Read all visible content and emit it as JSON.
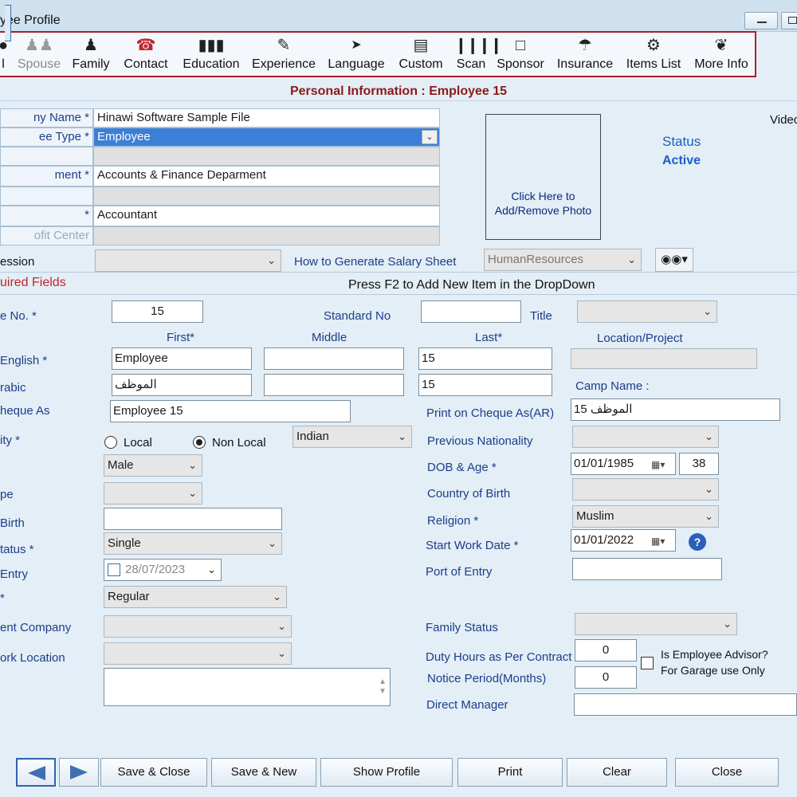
{
  "window": {
    "title": "yee Profile"
  },
  "colors": {
    "toolbar_border": "#a8212a",
    "header_text": "#8b1a1a",
    "label_blue": "#1c3d8a",
    "selection": "#3c7fd6"
  },
  "toolbar": {
    "items": [
      {
        "label": "l",
        "icon": "person-icon"
      },
      {
        "label": "Spouse",
        "icon": "couple-icon"
      },
      {
        "label": "Family",
        "icon": "family-icon"
      },
      {
        "label": "Contact",
        "icon": "phone-icon"
      },
      {
        "label": "Education",
        "icon": "books-icon"
      },
      {
        "label": "Experience",
        "icon": "certificate-icon"
      },
      {
        "label": "Language",
        "icon": "language-icon"
      },
      {
        "label": "Custom",
        "icon": "custom-icon"
      },
      {
        "label": "Scan",
        "icon": "barcode-icon"
      },
      {
        "label": "Sponsor",
        "icon": "sponsor-icon"
      },
      {
        "label": "Insurance",
        "icon": "umbrella-icon"
      },
      {
        "label": "Items List",
        "icon": "tools-icon"
      },
      {
        "label": "More Info",
        "icon": "handshake-icon"
      }
    ]
  },
  "header": {
    "personal_info": "Personal Information : Employee 15"
  },
  "top_grid": {
    "rows": [
      {
        "label": "ny Name  *",
        "value": "Hinawi Software Sample File"
      },
      {
        "label": "ee Type  *",
        "value": "Employee"
      },
      {
        "label": "",
        "value": ""
      },
      {
        "label": "ment  *",
        "value": "Accounts & Finance Deparment"
      },
      {
        "label": "",
        "value": ""
      },
      {
        "label": "*",
        "value": "Accountant"
      },
      {
        "label": "ofit Center",
        "value": ""
      }
    ]
  },
  "photo": {
    "text": "Click Here to Add/Remove Photo"
  },
  "status": {
    "label": "Status",
    "value": "Active"
  },
  "video_label": "Videc",
  "profession_label": "ession",
  "salary_sheet_label": "How to Generate Salary Sheet",
  "hr_dropdown": "HumanResources",
  "binoculars_icon": "binoculars-icon",
  "required_fields": "uired Fields",
  "press_f2": "Press F2 to Add New Item in the DropDown",
  "form": {
    "employee_no_label": "e No.  *",
    "employee_no": "15",
    "standard_no_label": "Standard No",
    "standard_no": "",
    "title_label": "Title",
    "first_label": "First*",
    "middle_label": "Middle",
    "last_label": "Last*",
    "location_label": "Location/Project",
    "name_en_label": "English  *",
    "first_en": "Employee",
    "middle_en": "",
    "last_en": "15",
    "name_ar_label": "rabic",
    "first_ar": "الموظف",
    "middle_ar": "",
    "last_ar": "15",
    "camp_label": "Camp Name :",
    "cheque_label": "heque As",
    "cheque_value": "Employee 15",
    "cheque_ar_label": "Print on Cheque As(AR)",
    "cheque_ar_value": "الموظف 15",
    "nationality_label": "ity  *",
    "local_label": "Local",
    "nonlocal_label": "Non Local",
    "nationality_value": "Indian",
    "prev_nationality_label": "Previous Nationality",
    "gender_value": "Male",
    "dob_label": "DOB & Age  *",
    "dob_value": "01/01/1985",
    "age_value": "38",
    "type_label": "pe",
    "country_birth_label": "Country of Birth",
    "place_birth_label": "Birth",
    "religion_label": "Religion  *",
    "religion_value": "Muslim",
    "marital_label": "tatus  *",
    "marital_value": "Single",
    "start_work_label": "Start Work Date  *",
    "start_work_value": "01/01/2022",
    "entry_label": "Entry",
    "entry_value": "28/07/2023",
    "port_entry_label": "Port of Entry",
    "star_label": "*",
    "regular_value": "Regular",
    "company_label": "ent Company",
    "family_status_label": "Family Status",
    "work_location_label": "ork Location",
    "duty_hours_label": "Duty Hours as Per Contract",
    "duty_hours_value": "0",
    "notice_label": "Notice Period(Months)",
    "notice_value": "0",
    "advisor_label": "Is Employee Advisor?",
    "advisor_sub": "For Garage use Only",
    "direct_manager_label": "Direct Manager"
  },
  "buttons": {
    "save_close": "Save & Close",
    "save_new": "Save & New",
    "show_profile": "Show Profile",
    "print": "Print",
    "clear": "Clear",
    "close": "Close"
  }
}
